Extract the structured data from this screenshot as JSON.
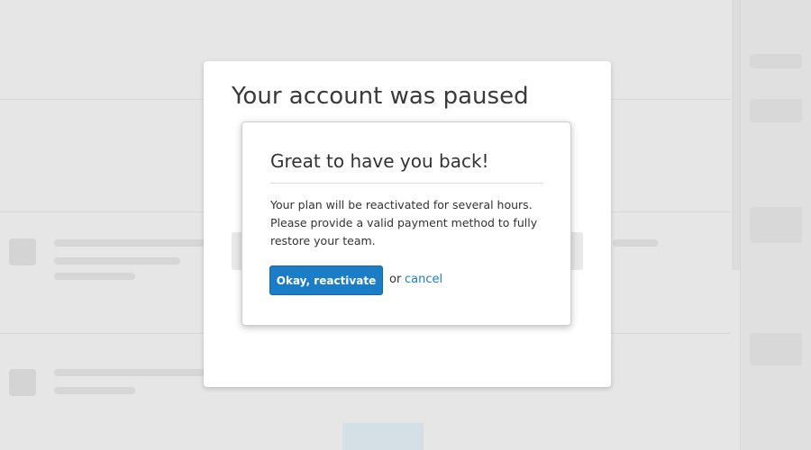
{
  "outer_modal": {
    "title": "Your account was paused"
  },
  "dialog": {
    "title": "Great to have you back!",
    "message": "Your plan will be reactivated for several hours. Please provide a valid payment method to fully restore your team.",
    "primary_button_label": "Okay, reactivate",
    "or_text": "or",
    "cancel_label": "cancel"
  },
  "colors": {
    "primary": "#1a7dc6",
    "link": "#1a7dc6"
  }
}
